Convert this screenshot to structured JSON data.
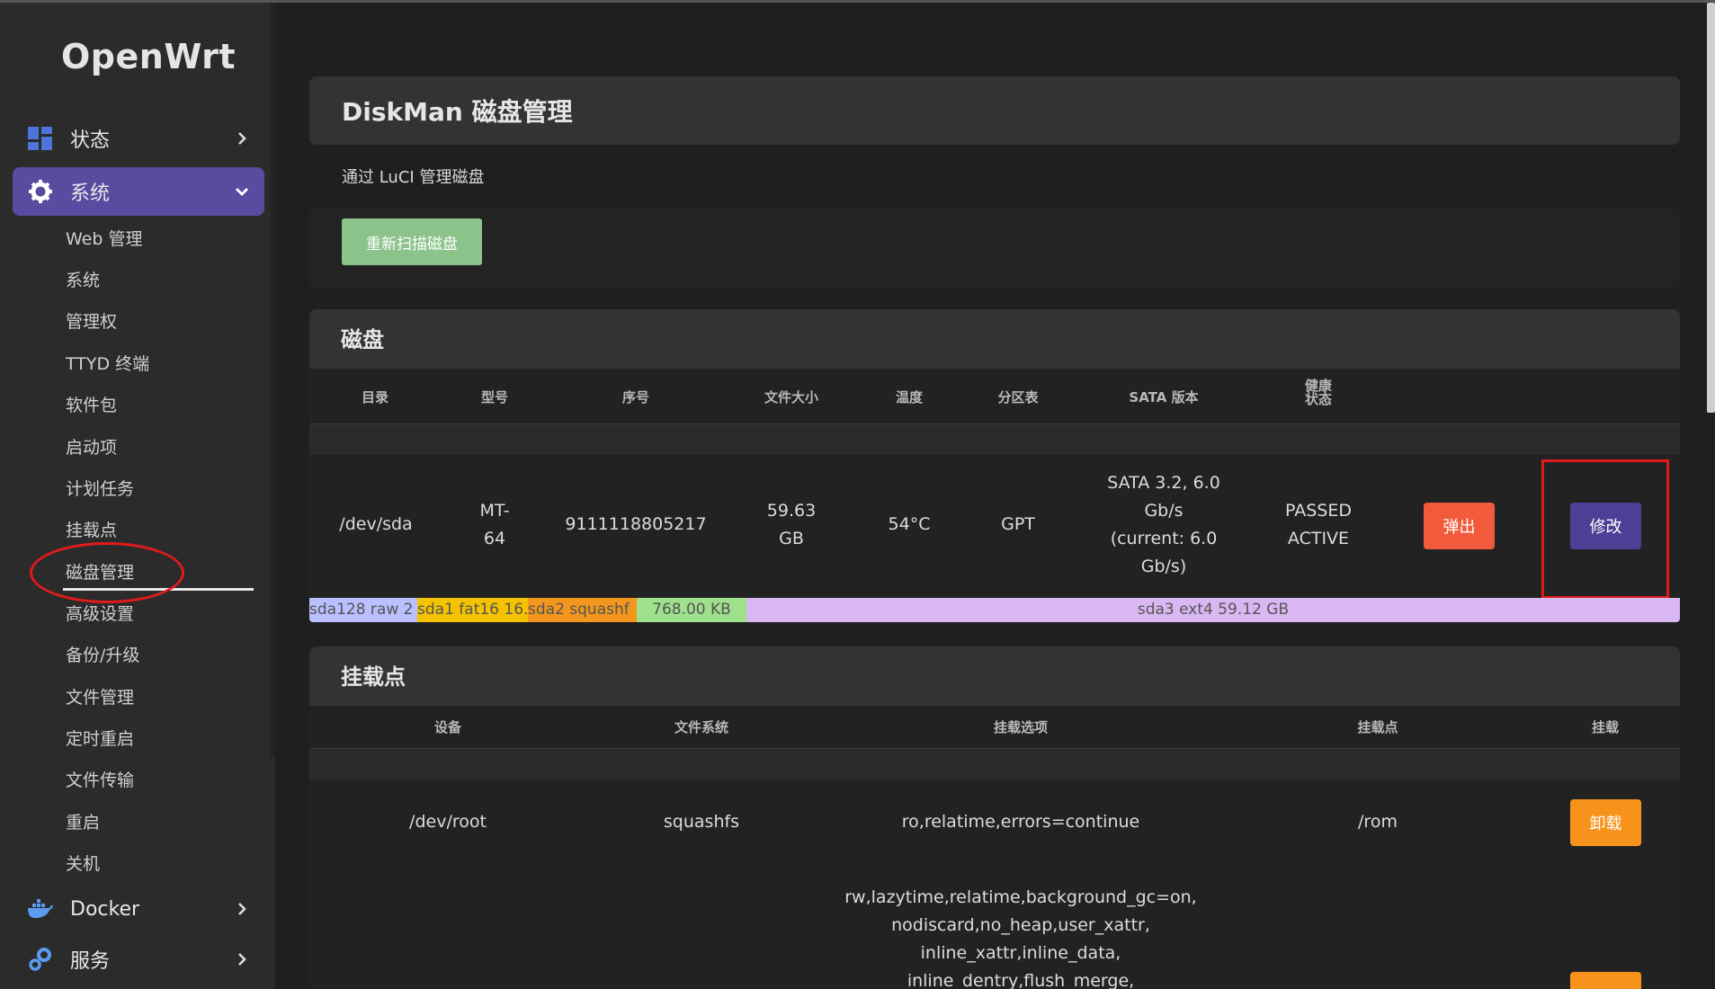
{
  "sidebar": {
    "logo": "OpenWrt",
    "status": {
      "label": "状态",
      "icon": "dashboard-icon"
    },
    "system": {
      "label": "系统",
      "icon": "gear-icon"
    },
    "system_items": [
      "Web 管理",
      "系统",
      "管理权",
      "TTYD 终端",
      "软件包",
      "启动项",
      "计划任务",
      "挂载点",
      "磁盘管理",
      "高级设置",
      "备份/升级",
      "文件管理",
      "定时重启",
      "文件传输",
      "重启",
      "关机"
    ],
    "docker": {
      "label": "Docker",
      "icon": "docker-icon"
    },
    "services": {
      "label": "服务",
      "icon": "services-icon"
    }
  },
  "page": {
    "title": "DiskMan 磁盘管理",
    "description": "通过 LuCI 管理磁盘",
    "rescan_label": "重新扫描磁盘"
  },
  "disks": {
    "section_title": "磁盘",
    "headers": [
      "目录",
      "型号",
      "序号",
      "文件大小",
      "温度",
      "分区表",
      "SATA 版本",
      "健康\n状态"
    ],
    "row": {
      "path": "/dev/sda",
      "model": "MT-\n64",
      "serial": "9111118805217",
      "size": "59.63\nGB",
      "temp": "54°C",
      "table": "GPT",
      "sata": "SATA 3.2, 6.0\nGb/s\n(current: 6.0\nGb/s)",
      "health": "PASSED\nACTIVE",
      "eject_label": "弹出",
      "edit_label": "修改"
    },
    "partitions": [
      {
        "label": "sda128 raw 2",
        "color": "#b9bfff"
      },
      {
        "label": "sda1 fat16 16.",
        "color": "#f5c200"
      },
      {
        "label": "sda2 squashf",
        "color": "#f2961d"
      },
      {
        "label": "768.00 KB",
        "color": "#9fe08d"
      },
      {
        "label": "sda3 ext4 59.12 GB",
        "color": "#d9b7f2"
      }
    ]
  },
  "mounts": {
    "section_title": "挂载点",
    "headers": [
      "设备",
      "文件系统",
      "挂载选项",
      "挂载点",
      "挂载"
    ],
    "rows": [
      {
        "device": "/dev/root",
        "fs": "squashfs",
        "options": "ro,relatime,errors=continue",
        "mountpoint": "/rom",
        "action": "卸载"
      },
      {
        "device": "",
        "fs": "",
        "options": "rw,lazytime,relatime,background_gc=on,\nnodiscard,no_heap,user_xattr,\ninline_xattr,inline_data,\ninline_dentry,flush_merge,",
        "mountpoint": "",
        "action": ""
      }
    ]
  }
}
